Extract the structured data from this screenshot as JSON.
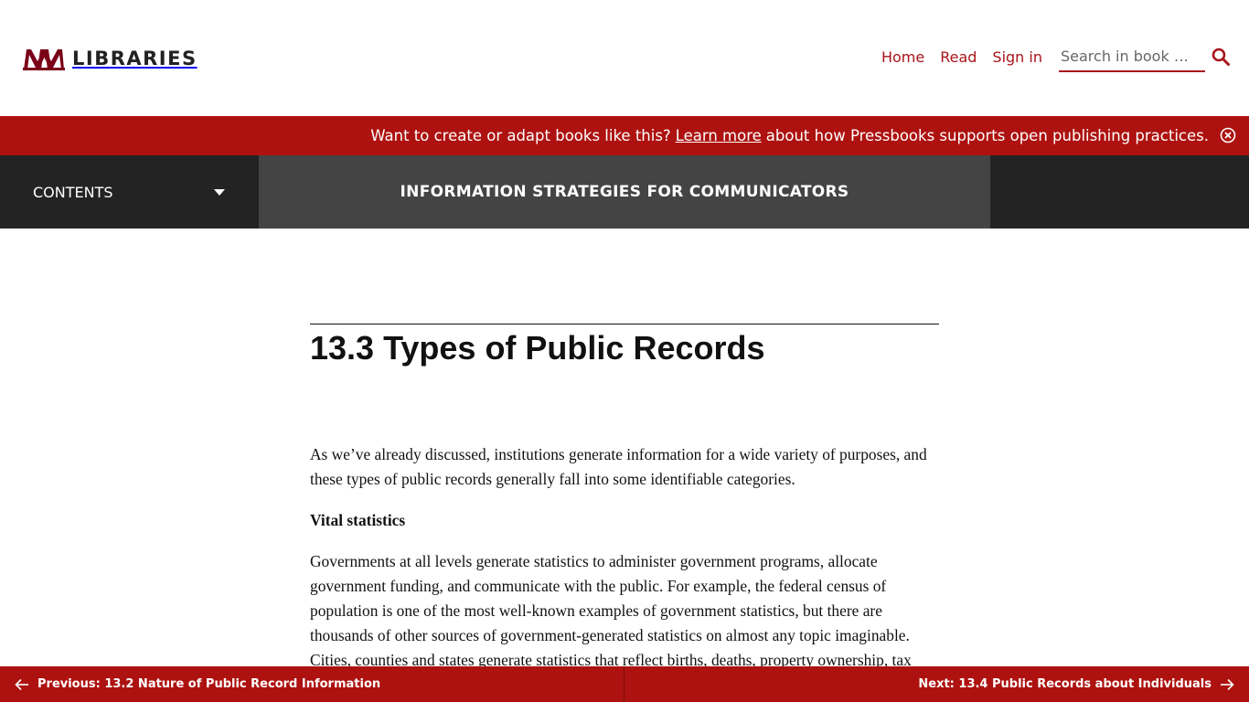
{
  "header": {
    "logo_mark": "M",
    "logo_text": "LIBRARIES",
    "nav": {
      "home": "Home",
      "read": "Read",
      "sign_in": "Sign in"
    },
    "search": {
      "placeholder": "Search in book …",
      "icon": "search-icon"
    }
  },
  "banner": {
    "text_before": "Want to create or adapt books like this?",
    "link": "Learn more",
    "text_after": "about how Pressbooks supports open publishing practices.",
    "close_icon": "close-circle-icon"
  },
  "bookbar": {
    "contents_label": "CONTENTS",
    "book_title": "INFORMATION STRATEGIES FOR COMMUNICATORS"
  },
  "chapter": {
    "title": "13.3 Types of Public Records",
    "intro": "As we’ve already discussed, institutions generate information for a wide variety of purposes, and these types of public records generally fall into some identifiable categories.",
    "subhead": "Vital statistics",
    "paragraph": "Governments at all levels generate statistics to administer government programs, allocate government funding, and communicate with the public. For example, the federal census of population is one of the most well-known examples of government statistics, but there are thousands of other sources of government-generated statistics on almost any topic imaginable. Cities, counties and states generate statistics that reflect births, deaths, property ownership, tax"
  },
  "footer": {
    "previous": "Previous: 13.2 Nature of Public Record Information",
    "next": "Next: 13.4 Public Records about Individuals"
  },
  "colors": {
    "brand_red": "#ad1210",
    "dark_bar": "#232323",
    "title_bar": "#444444"
  }
}
